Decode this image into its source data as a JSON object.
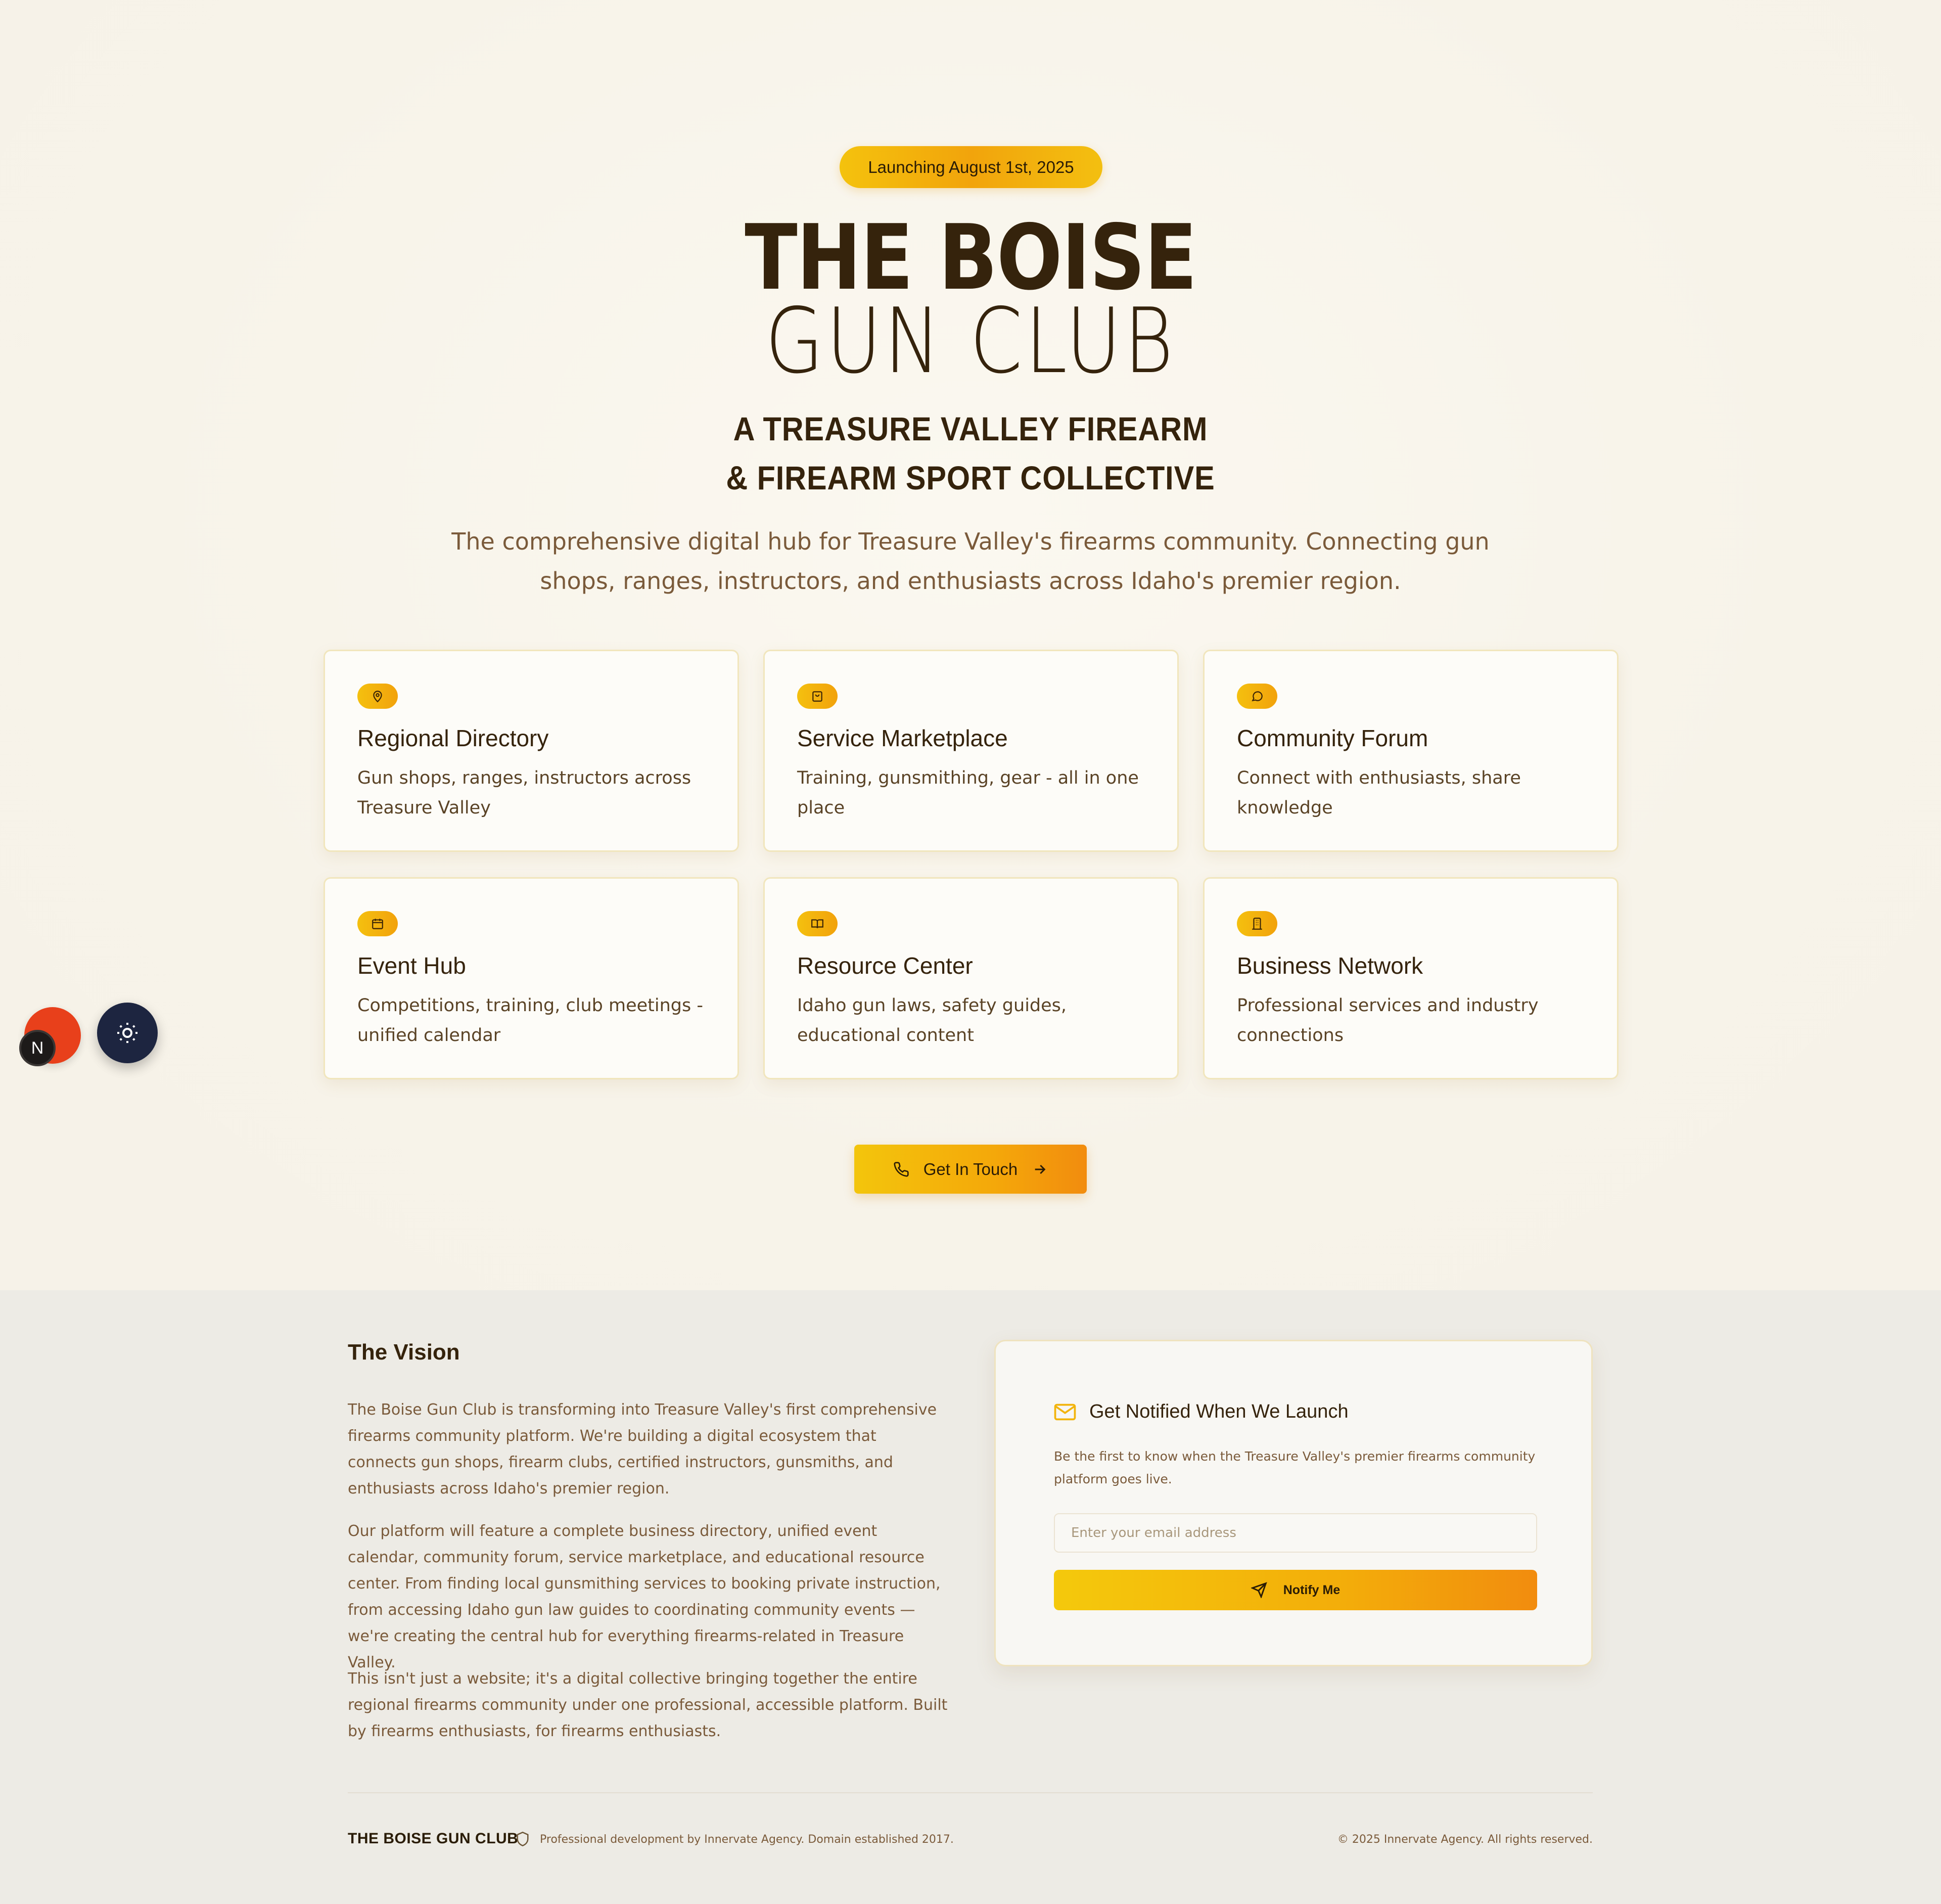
{
  "hero": {
    "badge": "Launching August 1st, 2025",
    "title_line1": "THE BOISE",
    "title_line2": "GUN CLUB",
    "subtitle_line1": "A TREASURE VALLEY FIREARM",
    "subtitle_line2": "& FIREARM SPORT COLLECTIVE",
    "lead": "The comprehensive digital hub for Treasure Valley's firearms community. Connecting gun shops, ranges, instructors, and enthusiasts across Idaho's premier region."
  },
  "features": [
    {
      "icon": "map-pin-icon",
      "title": "Regional Directory",
      "desc": "Gun shops, ranges, instructors across Treasure Valley"
    },
    {
      "icon": "shopping-bag-icon",
      "title": "Service Marketplace",
      "desc": "Training, gunsmithing, gear - all in one place"
    },
    {
      "icon": "chat-bubble-icon",
      "title": "Community Forum",
      "desc": "Connect with enthusiasts, share knowledge"
    },
    {
      "icon": "calendar-icon",
      "title": "Event Hub",
      "desc": "Competitions, training, club meetings - unified calendar"
    },
    {
      "icon": "open-book-icon",
      "title": "Resource Center",
      "desc": "Idaho gun laws, safety guides, educational content"
    },
    {
      "icon": "building-icon",
      "title": "Business Network",
      "desc": "Professional services and industry connections"
    }
  ],
  "cta": {
    "label": "Get In Touch"
  },
  "vision": {
    "heading": "The Vision",
    "paragraphs": [
      "The Boise Gun Club is transforming into Treasure Valley's first comprehensive firearms community platform. We're building a digital ecosystem that connects gun shops, firearm clubs, certified instructors, gunsmiths, and enthusiasts across Idaho's premier region.",
      "Our platform will feature a complete business directory, unified event calendar, community forum, service marketplace, and educational resource center. From finding local gunsmithing services to booking private instruction, from accessing Idaho gun law guides to coordinating community events — we're creating the central hub for everything firearms-related in Treasure Valley.",
      "This isn't just a website; it's a digital collective bringing together the entire regional firearms community under one professional, accessible platform. Built by firearms enthusiasts, for firearms enthusiasts."
    ]
  },
  "notify": {
    "title": "Get Notified When We Launch",
    "desc": "Be the first to know when the Treasure Valley's premier firearms community platform goes live.",
    "placeholder": "Enter your email address",
    "button": "Notify Me"
  },
  "footer": {
    "brand": "THE BOISE GUN CLUB",
    "note": "Professional development by Innervate Agency. Domain established 2017.",
    "copyright": "© 2025 Innervate Agency. All rights reserved."
  },
  "floating": {
    "dev_badge": "N"
  },
  "colors": {
    "accent": "#f4b40c",
    "accent_end": "#f28c0e",
    "text_dark": "#35230c",
    "text_muted": "#7a5a3a",
    "theme_button": "#1d2540",
    "dev_tools": "#e8401b"
  }
}
